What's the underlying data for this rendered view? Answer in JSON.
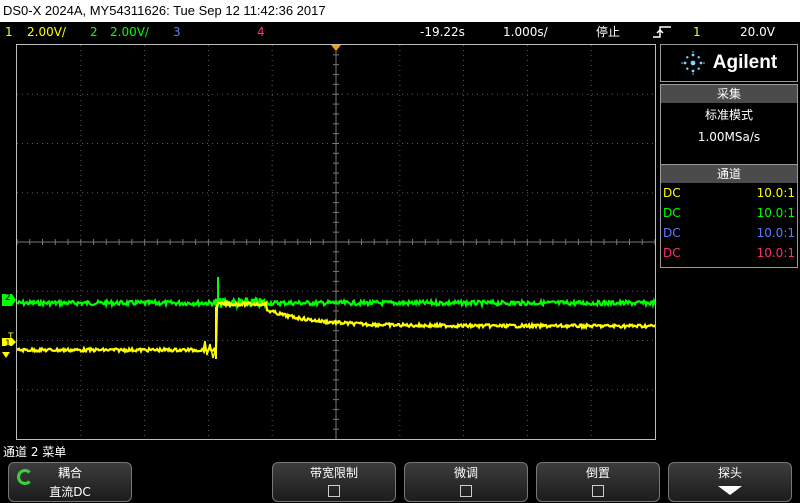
{
  "title": "DS0-X 2024A, MY54311626: Tue Sep 12 11:42:36 2017",
  "channels_bar": {
    "ch1_num": "1",
    "ch1_scale": "2.00V/",
    "ch2_num": "2",
    "ch2_scale": "2.00V/",
    "ch3_num": "3",
    "ch4_num": "4",
    "time_delay": "-19.22s",
    "time_scale": "1.000s/",
    "run_state": "停止",
    "trigger_icon": "trigger-edge-icon",
    "trigger_channel": "1",
    "trigger_level": "20.0V"
  },
  "markers": {
    "trigger_marker": "T",
    "ch1_marker": "1",
    "ch2_marker": "2"
  },
  "logo": {
    "brand": "Agilent"
  },
  "acquisition": {
    "header": "采集",
    "mode": "标准模式",
    "rate": "1.00MSa/s"
  },
  "channels_panel": {
    "header": "通道",
    "rows": [
      {
        "coupling": "DC",
        "probe": "10.0:1",
        "color": "#ffff00"
      },
      {
        "coupling": "DC",
        "probe": "10.0:1",
        "color": "#00ff00"
      },
      {
        "coupling": "DC",
        "probe": "10.0:1",
        "color": "#5a7cff"
      },
      {
        "coupling": "DC",
        "probe": "10.0:1",
        "color": "#ff2d7a"
      }
    ]
  },
  "menu_title": "通道 2 菜单",
  "softkeys": {
    "coupling_label": "耦合",
    "coupling_value": "直流DC",
    "bw_limit_label": "带宽限制",
    "fine_label": "微调",
    "invert_label": "倒置",
    "probe_label": "探头"
  },
  "colors": {
    "ch1": "#ffff00",
    "ch2": "#00ff00",
    "ch3": "#5a7cff",
    "ch4": "#ff2d7a",
    "delay_marker": "#ff9a00"
  }
}
